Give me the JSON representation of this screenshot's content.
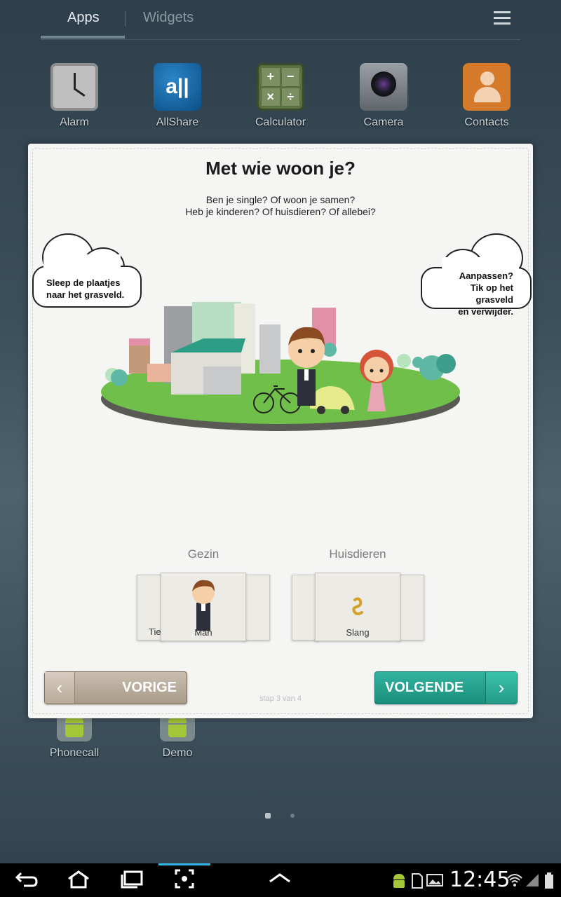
{
  "launcher": {
    "tabs": {
      "apps": "Apps",
      "widgets": "Widgets"
    },
    "apps_row": [
      "Alarm",
      "AllShare",
      "Calculator",
      "Camera",
      "Contacts"
    ],
    "apps_row2": [
      "Phonecall",
      "Demo"
    ],
    "icons": {
      "alarm": "alarm-clock-icon",
      "allshare": "allshare-icon",
      "calculator": "calculator-icon",
      "camera": "camera-icon",
      "contacts": "contacts-icon",
      "android": "android-icon",
      "menu": "menu-icon"
    },
    "allshare_glyph": "a||",
    "calc_keys": [
      "+",
      "−",
      "×",
      "÷"
    ]
  },
  "dialog": {
    "title": "Met wie woon je?",
    "subtitle_line1": "Ben je single? Of woon je samen?",
    "subtitle_line2": "Heb je kinderen? Of huisdieren? Of allebei?",
    "cloud_left_line1": "Sleep de plaatjes",
    "cloud_left_line2": "naar het grasveld.",
    "cloud_right_line1": "Aanpassen?",
    "cloud_right_line2": "Tik op het grasveld",
    "cloud_right_line3": "en verwijder.",
    "categories": {
      "family": {
        "label": "Gezin",
        "current": "Man",
        "behind": "Tie"
      },
      "pets": {
        "label": "Huisdieren",
        "current": "Slang"
      }
    },
    "prev_label": "VORIGE",
    "next_label": "VOLGENDE",
    "step_text": "stap 3 van 4",
    "colors": {
      "prev": "#a89a88",
      "next": "#1f9b87",
      "grass": "#6fbf4a"
    }
  },
  "system": {
    "clock": "12:45",
    "nav_icons": [
      "back-icon",
      "home-icon",
      "recent-apps-icon",
      "screen-capture-icon",
      "up-arrow-icon"
    ],
    "status_icons": [
      "android-debug-icon",
      "sd-card-icon",
      "gallery-icon",
      "wifi-icon",
      "signal-icon",
      "battery-icon"
    ]
  }
}
